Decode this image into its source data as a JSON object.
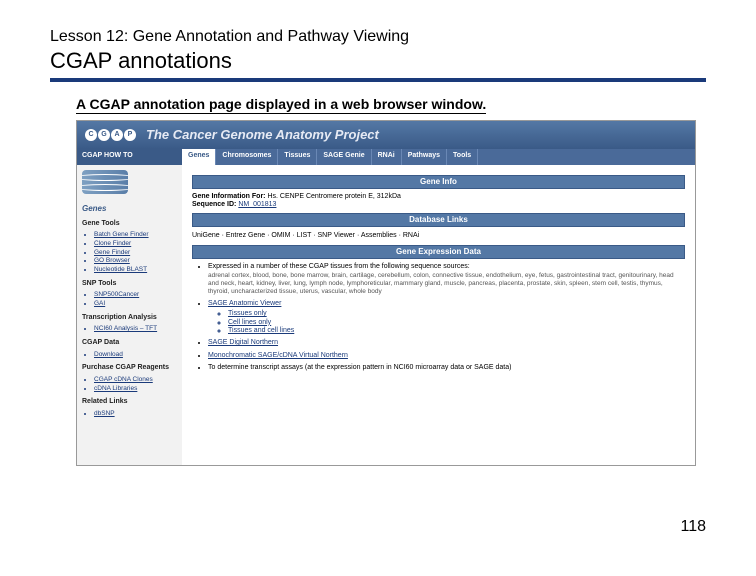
{
  "lesson": "Lesson 12: Gene Annotation and Pathway Viewing",
  "title": "CGAP annotations",
  "description": "A CGAP annotation page displayed in a web browser window.",
  "page_number": "118",
  "brand": {
    "logo_letters": [
      "C",
      "G",
      "A",
      "P"
    ],
    "title": "The Cancer Genome Anatomy Project"
  },
  "nav": {
    "howto": "CGAP HOW TO",
    "tabs": [
      "Genes",
      "Chromosomes",
      "Tissues",
      "SAGE Genie",
      "RNAi",
      "Pathways",
      "Tools"
    ]
  },
  "sidebar": {
    "genes_label": "Genes",
    "gene_tools_h": "Gene Tools",
    "gene_tools": [
      "Batch Gene Finder",
      "Clone Finder",
      "Gene Finder",
      "GO Browser",
      "Nucleotide BLAST"
    ],
    "snp_h": "SNP Tools",
    "snp": [
      "SNP500Cancer",
      "GAI"
    ],
    "trans_h": "Transcription Analysis",
    "trans": [
      "NCI60 Analysis – TFT"
    ],
    "data_h": "CGAP Data",
    "data": [
      "Download"
    ],
    "purchase_h": "Purchase CGAP Reagents",
    "purchase": [
      "CGAP cDNA Clones",
      "cDNA Libraries"
    ],
    "related_h": "Related Links",
    "related": [
      "dbSNP"
    ]
  },
  "main": {
    "gene_info_bar": "Gene Info",
    "info_label": "Gene Information For:",
    "info_value": "Hs. CENPE  Centromere protein E, 312kDa",
    "seq_label": "Sequence ID:",
    "seq_value": "NM_001813",
    "db_bar": "Database Links",
    "db_line": "UniGene · Entrez Gene · OMIM · LIST · SNP Viewer · Assemblies · RNAi",
    "expr_bar": "Gene Expression Data",
    "expr1_lead": "Expressed in a number of these CGAP tissues from the following sequence sources:",
    "expr1_body": "adrenal cortex, blood, bone, bone marrow, brain, cartilage, cerebellum, colon, connective tissue, endothelium, eye, fetus, gastrointestinal tract, genitourinary, head and neck, heart, kidney, liver, lung, lymph node, lymphoreticular, mammary gland, muscle, pancreas, placenta, prostate, skin, spleen, stem cell, testis, thymus, thyroid, uncharacterized tissue, uterus, vascular, whole body",
    "sage_label": "SAGE Anatomic Viewer",
    "sage_items": [
      "Tissues only",
      "Cell lines only",
      "Tissues and cell lines"
    ],
    "digital_label": "SAGE Digital Northern",
    "mono_label": "Monochromatic SAGE/cDNA Virtual Northern",
    "nci_label": "To determine transcript assays (at the expression pattern in NCI60 microarray data or SAGE data)"
  }
}
